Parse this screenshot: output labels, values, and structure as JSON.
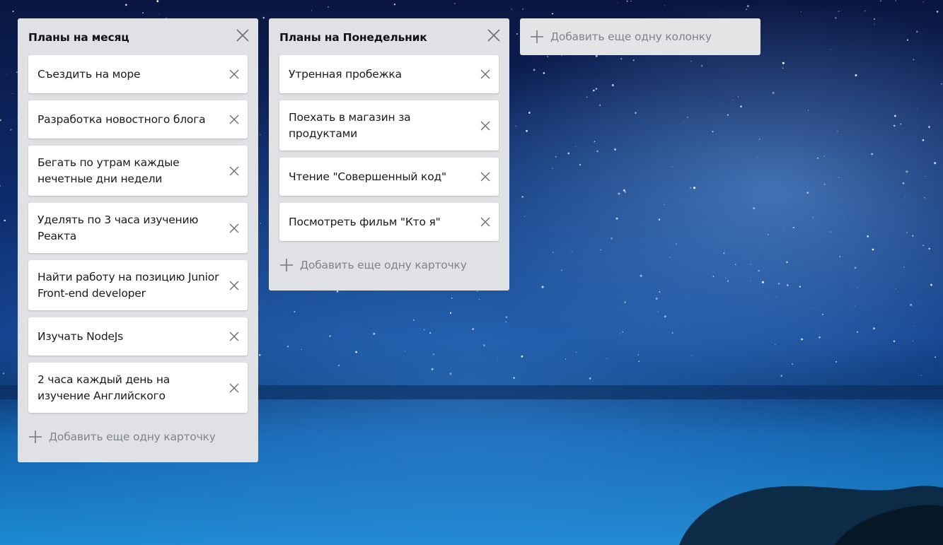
{
  "board": {
    "columns": [
      {
        "title": "Планы на месяц",
        "cards": [
          "Съездить на море",
          "Разработка новостного блога",
          "Бегать по утрам каждые нечетные дни недели",
          "Уделять по 3 часа изучению Реакта",
          "Найти работу на позицию Junior Front-end developer",
          "Изучать NodeJs",
          "2 часа каждый день на изучение Английского"
        ],
        "add_card_label": "Добавить еще одну карточку"
      },
      {
        "title": "Планы на Понедельник",
        "cards": [
          "Утренная пробежка",
          "Поехать в магазин за продуктами",
          "Чтение \"Совершенный код\"",
          "Посмотреть фильм \"Кто я\""
        ],
        "add_card_label": "Добавить еще одну карточку"
      }
    ],
    "add_column_label": "Добавить еще одну колонку"
  },
  "colors": {
    "column_bg": "#dfe1e4",
    "card_bg": "#ffffff",
    "muted_text": "#7f8489",
    "icon_gray": "#6b7075"
  },
  "icons": {
    "column_close": "close-icon",
    "card_close": "close-icon",
    "add": "plus-icon"
  }
}
